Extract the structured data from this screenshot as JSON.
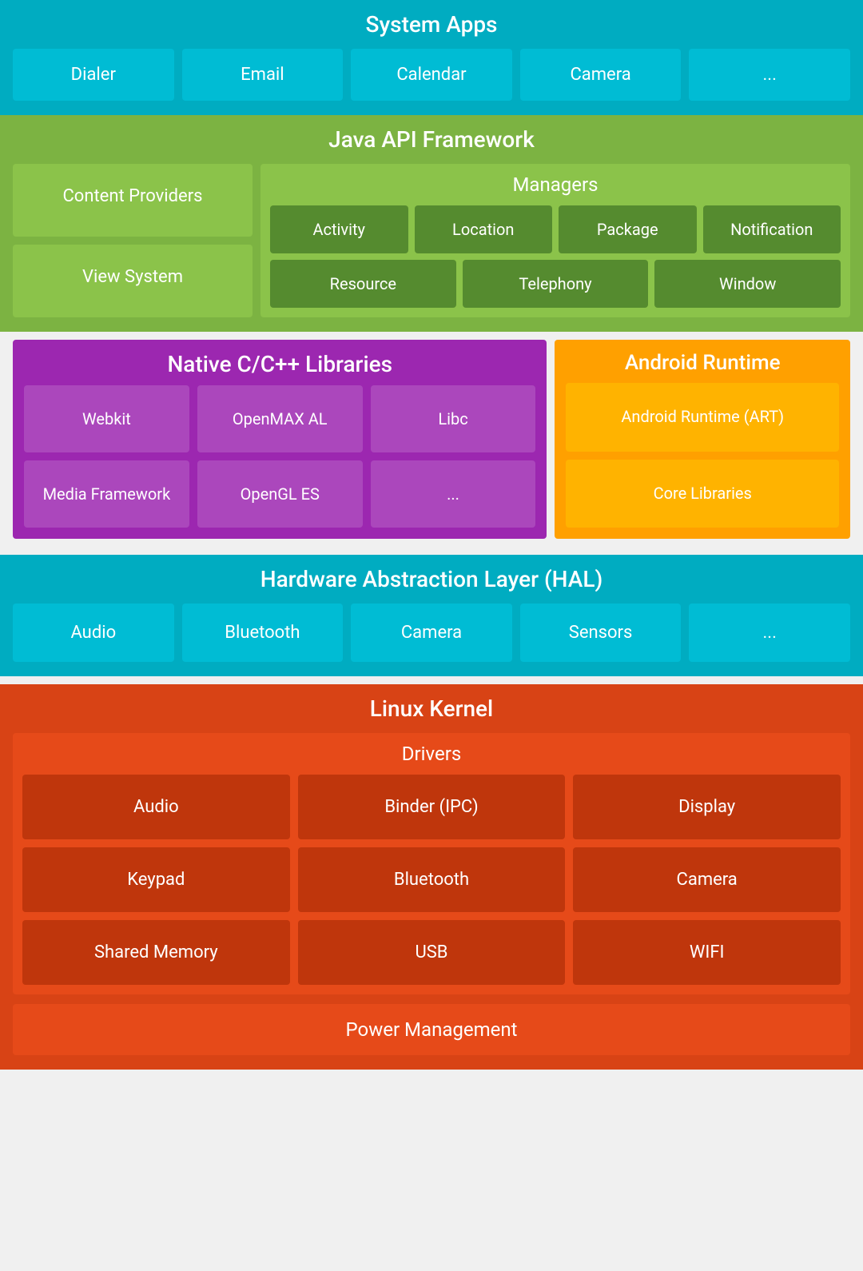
{
  "systemApps": {
    "title": "System Apps",
    "apps": [
      "Dialer",
      "Email",
      "Calendar",
      "Camera",
      "..."
    ]
  },
  "javaApi": {
    "title": "Java API Framework",
    "left": {
      "items": [
        "Content Providers",
        "View System"
      ]
    },
    "managers": {
      "title": "Managers",
      "row1": [
        "Activity",
        "Location",
        "Package",
        "Notification"
      ],
      "row2": [
        "Resource",
        "Telephony",
        "Window"
      ]
    }
  },
  "nativeLibs": {
    "title": "Native C/C++ Libraries",
    "items": [
      "Webkit",
      "OpenMAX AL",
      "Libc",
      "Media Framework",
      "OpenGL ES",
      "..."
    ]
  },
  "androidRuntime": {
    "title": "Android Runtime",
    "items": [
      "Android Runtime (ART)",
      "Core Libraries"
    ]
  },
  "hal": {
    "title": "Hardware Abstraction Layer (HAL)",
    "items": [
      "Audio",
      "Bluetooth",
      "Camera",
      "Sensors",
      "..."
    ]
  },
  "linuxKernel": {
    "title": "Linux Kernel",
    "drivers": {
      "title": "Drivers",
      "items": [
        "Audio",
        "Binder (IPC)",
        "Display",
        "Keypad",
        "Bluetooth",
        "Camera",
        "Shared Memory",
        "USB",
        "WIFI"
      ]
    },
    "powerManagement": "Power Management"
  }
}
